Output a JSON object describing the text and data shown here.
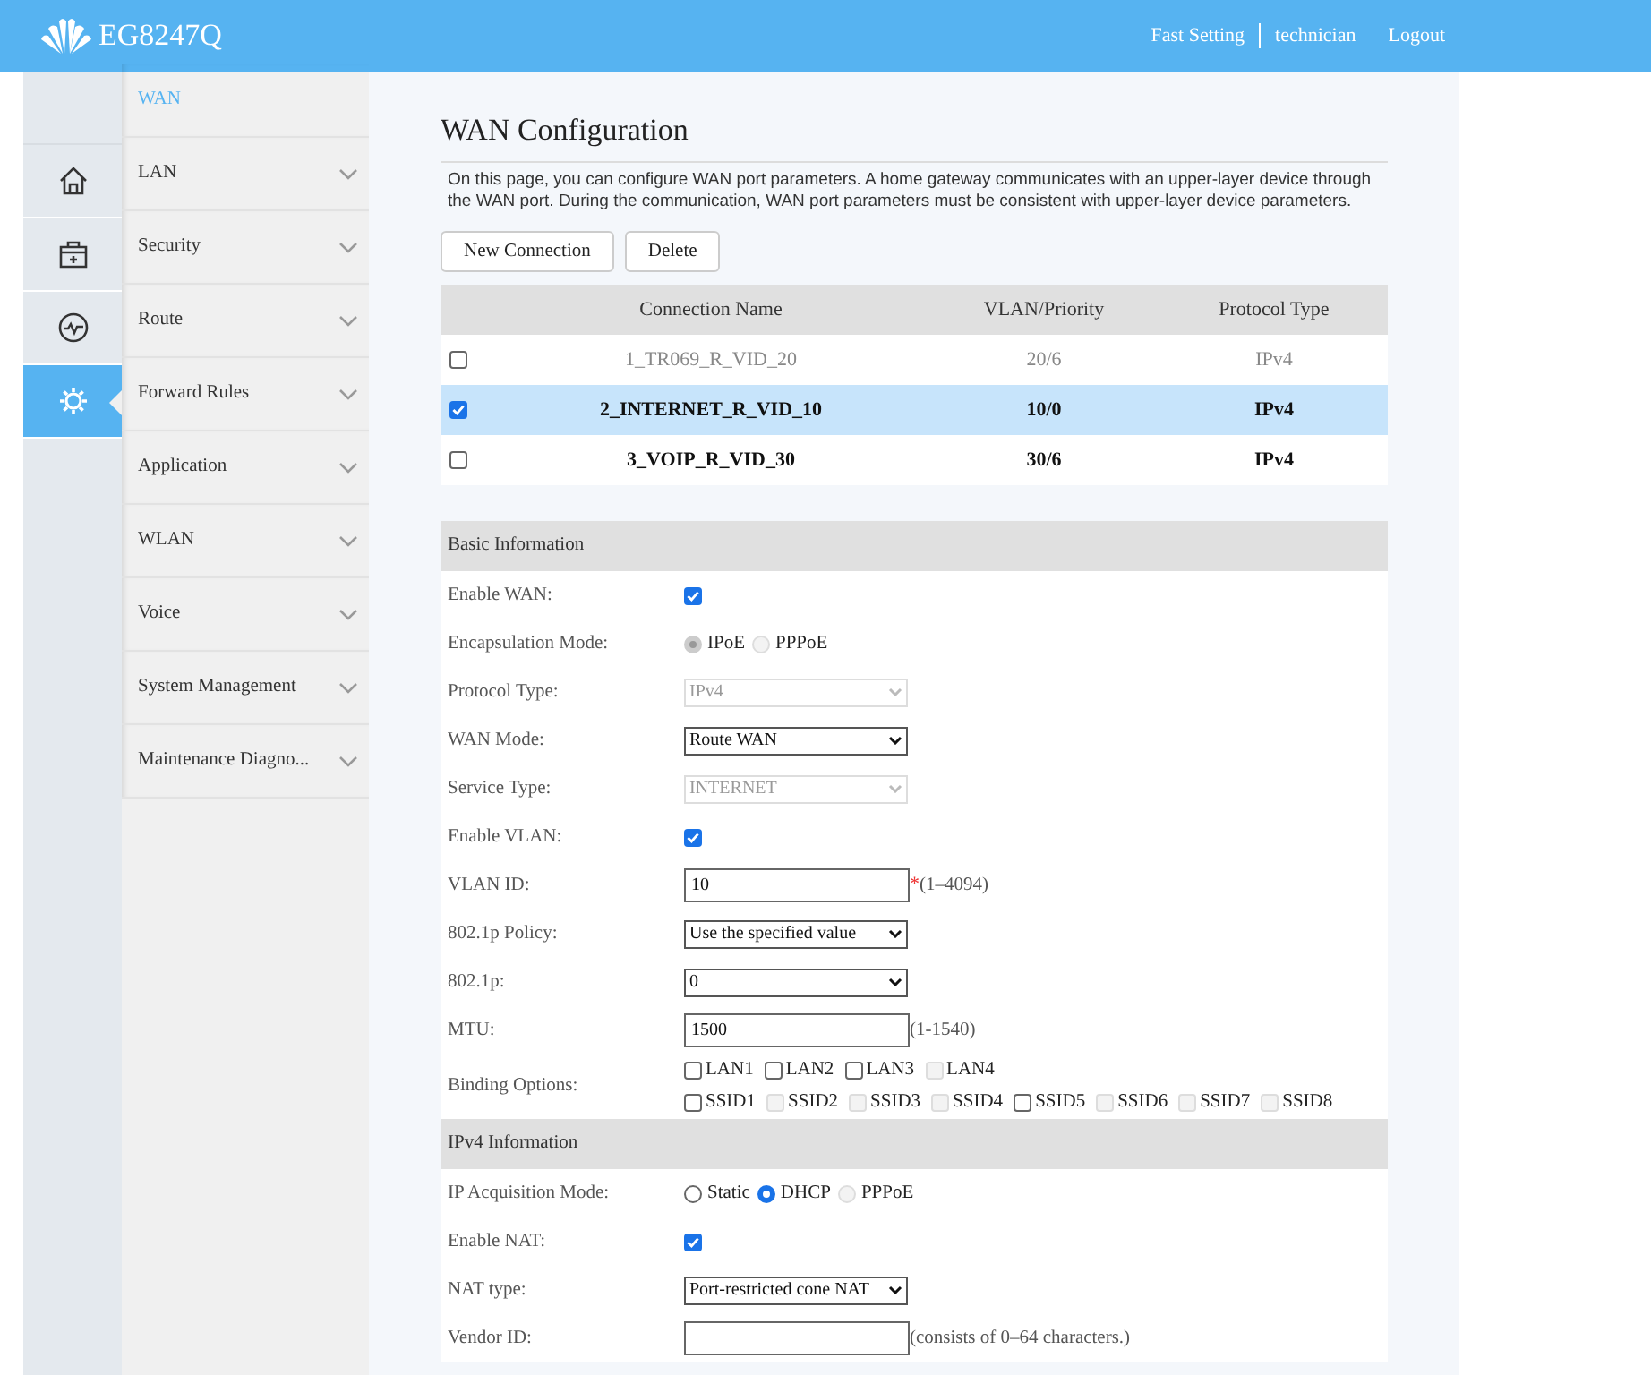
{
  "header": {
    "product": "EG8247Q",
    "links": [
      {
        "label": "Fast Setting"
      },
      {
        "label": "technician"
      },
      {
        "label": "Logout"
      }
    ]
  },
  "icon_bar": [
    {
      "kind": "home",
      "selected": false
    },
    {
      "kind": "toolbox",
      "selected": false
    },
    {
      "kind": "pulse",
      "selected": false
    },
    {
      "kind": "gear",
      "selected": true
    }
  ],
  "menu": [
    {
      "label": "WAN",
      "selected": true,
      "kind": "sub"
    },
    {
      "label": "LAN",
      "selected": false,
      "kind": "group"
    },
    {
      "label": "Security",
      "selected": false,
      "kind": "group"
    },
    {
      "label": "Route",
      "selected": false,
      "kind": "group"
    },
    {
      "label": "Forward Rules",
      "selected": false,
      "kind": "group"
    },
    {
      "label": "Application",
      "selected": false,
      "kind": "group"
    },
    {
      "label": "WLAN",
      "selected": false,
      "kind": "group"
    },
    {
      "label": "Voice",
      "selected": false,
      "kind": "group"
    },
    {
      "label": "System Management",
      "selected": false,
      "kind": "group"
    },
    {
      "label": "Maintenance Diagno...",
      "selected": false,
      "kind": "group"
    }
  ],
  "page": {
    "title": "WAN Configuration",
    "description": "On this page, you can configure WAN port parameters. A home gateway communicates with an upper-layer device through the WAN port. During the communication, WAN port parameters must be consistent with upper-layer device parameters.",
    "buttons": [
      {
        "label": "New Connection"
      },
      {
        "label": "Delete"
      }
    ]
  },
  "table": {
    "columns": [
      "Connection Name",
      "VLAN/Priority",
      "Protocol Type"
    ],
    "rows": [
      {
        "cells": [
          "1_TR069_R_VID_20",
          "20/6",
          "IPv4"
        ],
        "selected": false,
        "disabled": true
      },
      {
        "cells": [
          "2_INTERNET_R_VID_10",
          "10/0",
          "IPv4"
        ],
        "selected": true,
        "disabled": false
      },
      {
        "cells": [
          "3_VOIP_R_VID_30",
          "30/6",
          "IPv4"
        ],
        "selected": false,
        "disabled": false
      }
    ]
  },
  "sections": [
    {
      "title": "Basic Information",
      "rows": [
        {
          "label": "Enable WAN:",
          "kind": "checkbox",
          "checked": true
        },
        {
          "label": "Encapsulation Mode:",
          "kind": "radio",
          "options": [
            {
              "label": "IPoE",
              "selected": true,
              "disabled": true
            },
            {
              "label": "PPPoE",
              "selected": false,
              "disabled": true
            }
          ]
        },
        {
          "label": "Protocol Type:",
          "kind": "select",
          "value": "IPv4",
          "disabled": true
        },
        {
          "label": "WAN Mode:",
          "kind": "select",
          "value": "Route WAN",
          "disabled": false
        },
        {
          "label": "Service Type:",
          "kind": "select",
          "value": "INTERNET",
          "disabled": true
        },
        {
          "label": "Enable VLAN:",
          "kind": "checkbox",
          "checked": true
        },
        {
          "label": "VLAN ID:",
          "kind": "input",
          "value": "10",
          "required_mark": "*",
          "note": "(1–4094)"
        },
        {
          "label": "802.1p Policy:",
          "kind": "select",
          "value": "Use the specified value",
          "disabled": false
        },
        {
          "label": "802.1p:",
          "kind": "select",
          "value": "0",
          "disabled": false
        },
        {
          "label": "MTU:",
          "kind": "input",
          "value": "1500",
          "note": "(1-1540)"
        },
        {
          "label": "Binding Options:",
          "kind": "binding",
          "lines": [
            [
              {
                "label": "LAN1",
                "checked": false,
                "disabled": false
              },
              {
                "label": "LAN2",
                "checked": false,
                "disabled": false
              },
              {
                "label": "LAN3",
                "checked": false,
                "disabled": false
              },
              {
                "label": "LAN4",
                "checked": false,
                "disabled": true
              }
            ],
            [
              {
                "label": "SSID1",
                "checked": false,
                "disabled": false
              },
              {
                "label": "SSID2",
                "checked": false,
                "disabled": true
              },
              {
                "label": "SSID3",
                "checked": false,
                "disabled": true
              },
              {
                "label": "SSID4",
                "checked": false,
                "disabled": true
              },
              {
                "label": "SSID5",
                "checked": false,
                "disabled": false
              },
              {
                "label": "SSID6",
                "checked": false,
                "disabled": true
              },
              {
                "label": "SSID7",
                "checked": false,
                "disabled": true
              },
              {
                "label": "SSID8",
                "checked": false,
                "disabled": true
              }
            ]
          ]
        }
      ]
    },
    {
      "title": "IPv4 Information",
      "rows": [
        {
          "label": "IP Acquisition Mode:",
          "kind": "radio",
          "options": [
            {
              "label": "Static",
              "selected": false,
              "disabled": false
            },
            {
              "label": "DHCP",
              "selected": true,
              "disabled": false
            },
            {
              "label": "PPPoE",
              "selected": false,
              "disabled": true
            }
          ]
        },
        {
          "label": "Enable NAT:",
          "kind": "checkbox",
          "checked": true
        },
        {
          "label": "NAT type:",
          "kind": "select",
          "value": "Port-restricted cone NAT",
          "disabled": false
        },
        {
          "label": "Vendor ID:",
          "kind": "input",
          "note": "(consists of 0–64 characters.)"
        }
      ]
    }
  ]
}
